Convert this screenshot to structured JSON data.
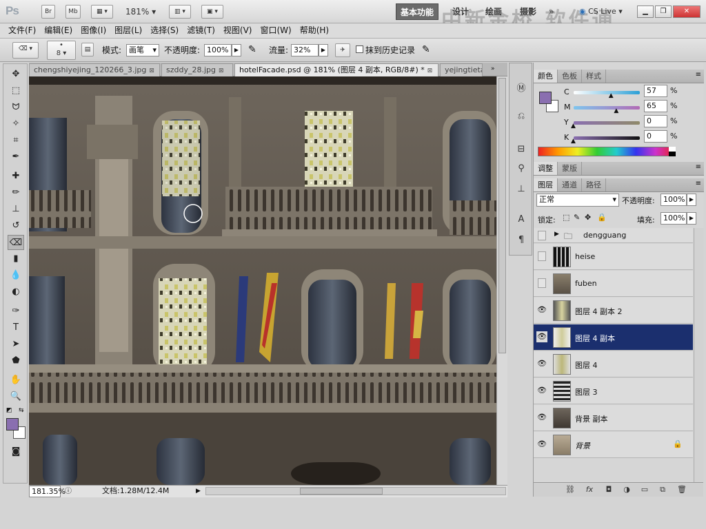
{
  "app": {
    "logo": "Ps",
    "bridge": "Br",
    "minibridge": "Mb",
    "zoom": "181%",
    "workspaces": [
      "基本功能",
      "设计",
      "绘画",
      "摄影"
    ],
    "more": "»",
    "cslive": "CS Live",
    "watermark": "中新金桥 软件通"
  },
  "menu": [
    "文件(F)",
    "编辑(E)",
    "图像(I)",
    "图层(L)",
    "选择(S)",
    "滤镜(T)",
    "视图(V)",
    "窗口(W)",
    "帮助(H)"
  ],
  "options": {
    "brush_size": "8",
    "mode_label": "模式:",
    "mode_value": "画笔",
    "opacity_label": "不透明度:",
    "opacity_value": "100%",
    "flow_label": "流量:",
    "flow_value": "32%",
    "history_label": "抹到历史记录"
  },
  "tabs": [
    {
      "label": "chengshiyejing_120266_3.jpg"
    },
    {
      "label": "szddy_28.jpg"
    },
    {
      "label": "hotelFacade.psd @ 181% (图层 4 副本, RGB/8#) *"
    },
    {
      "label": "yejingtieta"
    }
  ],
  "status": {
    "zoom": "181.35%",
    "doc": "文档:1.28M/12.4M"
  },
  "color_panel": {
    "tabs": [
      "颜色",
      "色板",
      "样式"
    ],
    "channels": [
      {
        "label": "C",
        "value": "57",
        "unit": "%",
        "pos": 0.57
      },
      {
        "label": "M",
        "value": "65",
        "unit": "%",
        "pos": 0.65
      },
      {
        "label": "Y",
        "value": "0",
        "unit": "%",
        "pos": 0.0
      },
      {
        "label": "K",
        "value": "0",
        "unit": "%",
        "pos": 0.0
      }
    ],
    "fg_color": "#8a6fb0",
    "bg_color": "#ffffff"
  },
  "adjust_panel": {
    "tabs": [
      "调整",
      "蒙版"
    ]
  },
  "layers_panel": {
    "tabs": [
      "图层",
      "通道",
      "路径"
    ],
    "blend_mode": "正常",
    "opacity_label": "不透明度:",
    "opacity_value": "100%",
    "lock_label": "锁定:",
    "fill_label": "填充:",
    "fill_value": "100%",
    "layers": [
      {
        "name": "dengguang",
        "visible": false,
        "group": true
      },
      {
        "name": "heise",
        "visible": false
      },
      {
        "name": "fuben",
        "visible": false
      },
      {
        "name": "图层 4 副本 2",
        "visible": true
      },
      {
        "name": "图层 4 副本",
        "visible": true,
        "selected": true
      },
      {
        "name": "图层 4",
        "visible": true
      },
      {
        "name": "图层 3",
        "visible": true
      },
      {
        "name": "背景 副本",
        "visible": true
      },
      {
        "name": "背景",
        "visible": true,
        "locked": true
      }
    ],
    "footer_icons": [
      "link-icon",
      "fx-icon",
      "mask-icon",
      "adjustment-icon",
      "folder-icon",
      "new-layer-icon",
      "trash-icon"
    ]
  }
}
